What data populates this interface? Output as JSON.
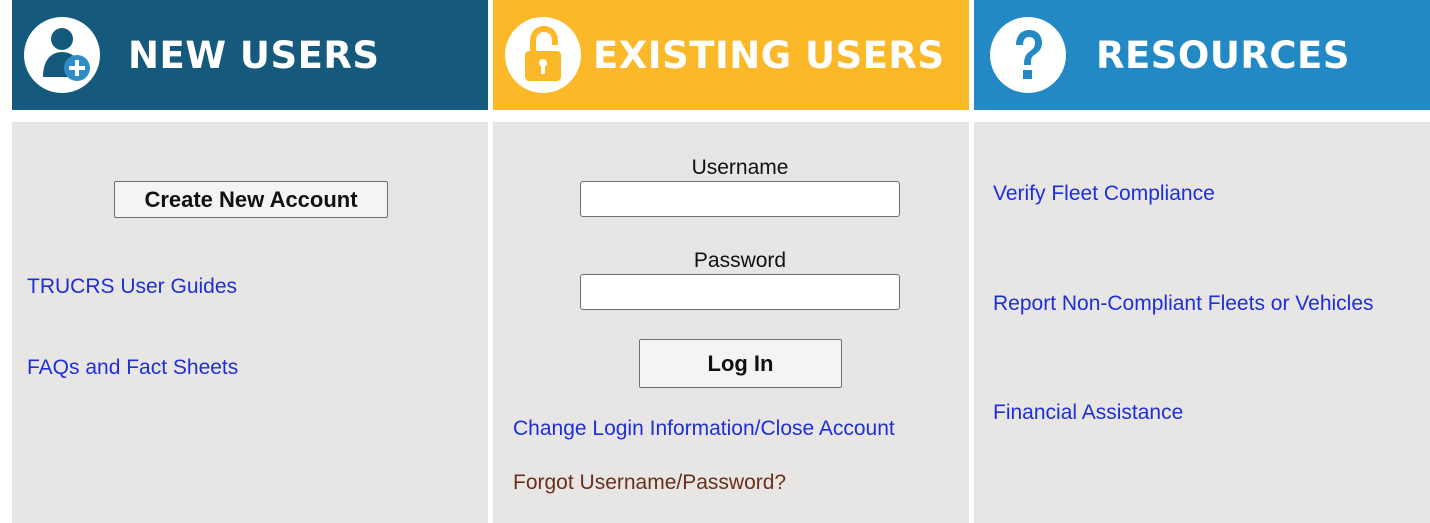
{
  "columns": {
    "new_users": {
      "title": "NEW USERS",
      "icon": "add-user-icon",
      "color": "#155a7d",
      "create_button_label": "Create New Account",
      "links": [
        "TRUCRS User Guides",
        "FAQs and Fact Sheets"
      ]
    },
    "existing_users": {
      "title": "EXISTING USERS",
      "icon": "padlock-icon",
      "color": "#fbb829",
      "username_label": "Username",
      "username_value": "",
      "password_label": "Password",
      "password_value": "",
      "login_button_label": "Log In",
      "change_login_link": "Change Login Information/Close Account",
      "forgot_link": "Forgot Username/Password?"
    },
    "resources": {
      "title": "RESOURCES",
      "icon": "question-icon",
      "color": "#2389c4",
      "links": [
        "Verify Fleet Compliance",
        "Report Non-Compliant Fleets or Vehicles",
        "Financial Assistance"
      ]
    }
  },
  "colors": {
    "panel_background": "#e7e6e4",
    "link": "#1f2fd8",
    "link_visited": "#6b2f1c"
  }
}
